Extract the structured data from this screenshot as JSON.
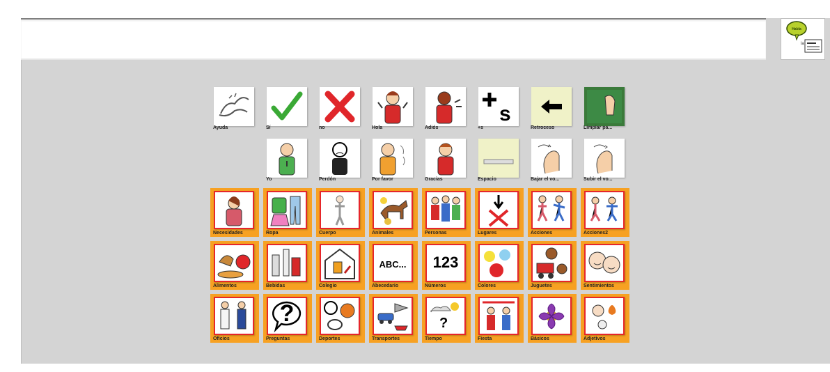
{
  "message_bar": {
    "value": ""
  },
  "speak_button": {
    "caption": "Habla"
  },
  "quick_row_1": [
    {
      "label": "Ayuda",
      "icon": "help-hands-icon"
    },
    {
      "label": "Sí",
      "icon": "checkmark-icon"
    },
    {
      "label": "no",
      "icon": "cross-icon"
    },
    {
      "label": "Hola",
      "icon": "wave-hello-icon"
    },
    {
      "label": "Adiós",
      "icon": "wave-goodbye-icon"
    },
    {
      "label": "+s",
      "icon": "plural-s-icon"
    },
    {
      "label": "Retroceso",
      "icon": "backspace-arrow-icon"
    },
    {
      "label": "Limpiar pa...",
      "icon": "clear-board-icon"
    }
  ],
  "quick_row_2": [
    {
      "label": "Yo",
      "icon": "me-icon"
    },
    {
      "label": "Perdón",
      "icon": "sorry-icon"
    },
    {
      "label": "Por favor",
      "icon": "please-icon"
    },
    {
      "label": "Gracias",
      "icon": "thanks-icon"
    },
    {
      "label": "Espacio",
      "icon": "space-bar-icon"
    },
    {
      "label": "Bajar el vo...",
      "icon": "volume-down-icon"
    },
    {
      "label": "Subir el vo...",
      "icon": "volume-up-icon"
    }
  ],
  "categories": [
    {
      "label": "Necesidades",
      "icon": "needs-icon"
    },
    {
      "label": "Ropa",
      "icon": "clothes-icon"
    },
    {
      "label": "Cuerpo",
      "icon": "body-icon"
    },
    {
      "label": "Animales",
      "icon": "animals-icon"
    },
    {
      "label": "Personas",
      "icon": "people-icon"
    },
    {
      "label": "Lugares",
      "icon": "places-icon"
    },
    {
      "label": "Acciones",
      "icon": "actions-icon"
    },
    {
      "label": "Acciones2",
      "icon": "actions2-icon"
    },
    {
      "label": "Alimentos",
      "icon": "food-icon"
    },
    {
      "label": "Bebidas",
      "icon": "drinks-icon"
    },
    {
      "label": "Colegio",
      "icon": "school-icon"
    },
    {
      "label": "Abecedario",
      "icon": "alphabet-icon",
      "glyph": "ABC..."
    },
    {
      "label": "Números",
      "icon": "numbers-icon",
      "glyph": "123"
    },
    {
      "label": "Colores",
      "icon": "colors-icon"
    },
    {
      "label": "Juguetes",
      "icon": "toys-icon"
    },
    {
      "label": "Sentimientos",
      "icon": "feelings-icon"
    },
    {
      "label": "Oficios",
      "icon": "jobs-icon"
    },
    {
      "label": "Preguntas",
      "icon": "questions-icon",
      "glyph": "?"
    },
    {
      "label": "Deportes",
      "icon": "sports-icon"
    },
    {
      "label": "Transportes",
      "icon": "transport-icon"
    },
    {
      "label": "Tiempo",
      "icon": "weather-icon"
    },
    {
      "label": "Fiesta",
      "icon": "party-icon"
    },
    {
      "label": "Básicos",
      "icon": "basics-icon"
    },
    {
      "label": "Adjetivos",
      "icon": "adjectives-icon"
    }
  ],
  "colors": {
    "category_frame": "#f7a122",
    "category_border": "#e6262a",
    "background": "#d4d4d4"
  }
}
